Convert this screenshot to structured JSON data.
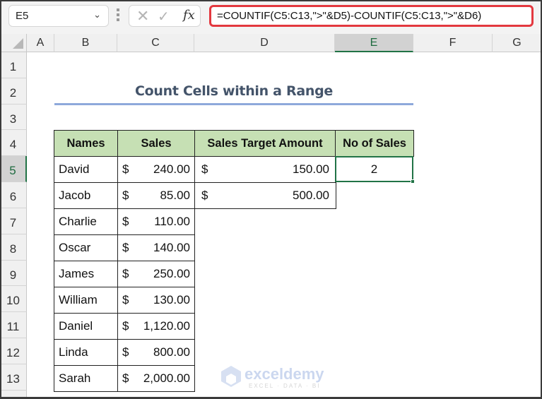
{
  "toolbar": {
    "name_box": "E5",
    "cancel_icon": "✕",
    "enter_icon": "✓",
    "fx_label": "fx",
    "formula": "=COUNTIF(C5:C13,\">\"&D5)-COUNTIF(C5:C13,\">\"&D6)"
  },
  "columns": [
    "A",
    "B",
    "C",
    "D",
    "E",
    "F",
    "G"
  ],
  "selected_column": "E",
  "rows": [
    "1",
    "2",
    "3",
    "4",
    "5",
    "6",
    "7",
    "8",
    "9",
    "10",
    "11",
    "12",
    "13"
  ],
  "selected_row": "5",
  "title": "Count Cells within a Range",
  "table": {
    "headers": [
      "Names",
      "Sales",
      "Sales Target Amount",
      "No of Sales"
    ],
    "rows": [
      {
        "name": "David",
        "currency": "$",
        "sales": "240.00"
      },
      {
        "name": "Jacob",
        "currency": "$",
        "sales": "85.00"
      },
      {
        "name": "Charlie",
        "currency": "$",
        "sales": "110.00"
      },
      {
        "name": "Oscar",
        "currency": "$",
        "sales": "140.00"
      },
      {
        "name": "James",
        "currency": "$",
        "sales": "250.00"
      },
      {
        "name": "William",
        "currency": "$",
        "sales": "130.00"
      },
      {
        "name": "Daniel",
        "currency": "$",
        "sales": "1,120.00"
      },
      {
        "name": "Linda",
        "currency": "$",
        "sales": "800.00"
      },
      {
        "name": "Sarah",
        "currency": "$",
        "sales": "2,000.00"
      }
    ],
    "targets": [
      {
        "currency": "$",
        "amount": "150.00"
      },
      {
        "currency": "$",
        "amount": "500.00"
      }
    ],
    "result": "2"
  },
  "watermark": {
    "name": "exceldemy",
    "tagline": "EXCEL · DATA · BI"
  },
  "colors": {
    "accent_green": "#217346",
    "header_fill": "#c6e0b4",
    "formula_highlight": "#e3383f",
    "title": "#44546a"
  }
}
